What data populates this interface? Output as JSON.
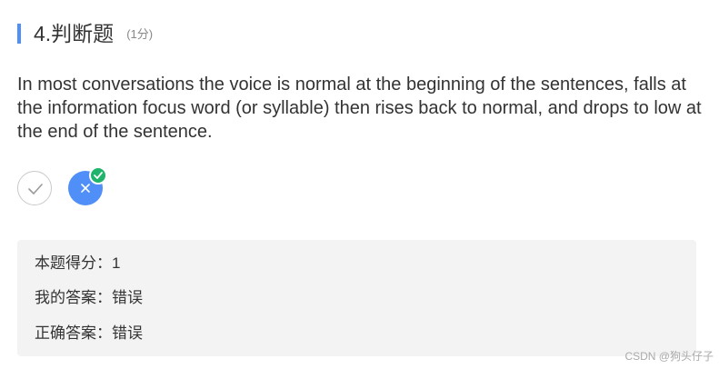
{
  "question": {
    "title": "4.判断题",
    "score": "(1分)",
    "text": "In most conversations the voice is normal at the beginning of the sentences, falls at the information focus word (or syllable) then rises back to normal, and drops to low at the end of the sentence."
  },
  "options": [
    {
      "name": "true",
      "icon": "check-icon",
      "selected": false
    },
    {
      "name": "false",
      "icon": "close-icon",
      "selected": true
    }
  ],
  "result": {
    "score_label": "本题得分：",
    "score_value": "1",
    "my_answer_label": "我的答案：",
    "my_answer_value": "错误",
    "correct_answer_label": "正确答案：",
    "correct_answer_value": "错误"
  },
  "watermark": "CSDN @狗头仔子",
  "colors": {
    "accent": "#4f8ff7",
    "selected_badge": "#1fb36b",
    "panel_bg": "#f3f3f3",
    "text": "#333333",
    "muted": "#888888"
  }
}
